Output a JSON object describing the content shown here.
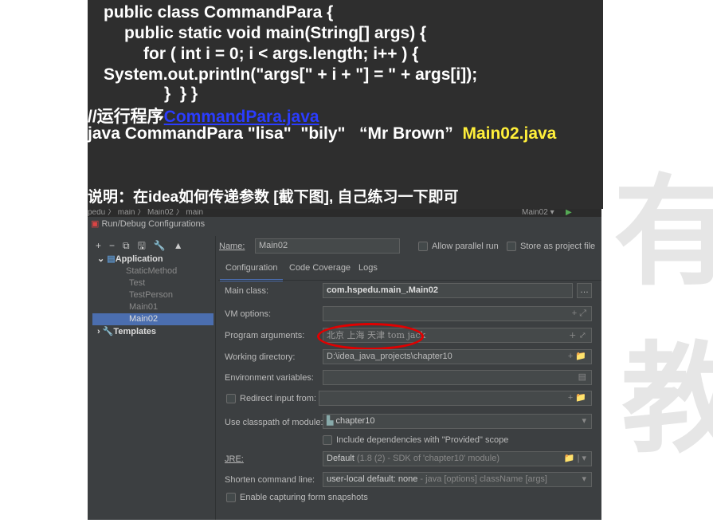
{
  "slide": {
    "code": [
      "public class CommandPara {",
      "public static void main(String[] args) {",
      "for ( int i = 0; i < args.length; i++ ) {",
      "System.out.println(\"args[\" + i + \"] = \" + args[i]);",
      "}  } }"
    ],
    "comment_prefix": "//运行程序",
    "comment_link": "CommandPara.java",
    "cmd": "java CommandPara \"lisa\"  \"bily\"   “Mr Brown”",
    "cmd_file": "Main02.java",
    "note": "说明：在idea如何传递参数 [截下图], 自己练习一下即可"
  },
  "ide": {
    "breadcrumb": "pedu 〉 main 〉 Main02 〉 main",
    "run_config": "Main02 ▾",
    "title": "Run/Debug Configurations",
    "toolbar": [
      "+",
      "−",
      "⧉",
      "🖫",
      "🔧",
      "▲"
    ],
    "tree": {
      "root": "Application",
      "items": [
        "StaticMethod",
        "Test",
        "TestPerson",
        "Main01",
        "Main02"
      ],
      "selected": "Main02",
      "templates": "Templates"
    },
    "name_label": "Name:",
    "name_value": "Main02",
    "allow_parallel": "Allow parallel run",
    "store_project": "Store as project file",
    "tabs": [
      "Configuration",
      "Code Coverage",
      "Logs"
    ],
    "main_class_label": "Main class:",
    "main_class": "com.hspedu.main_.Main02",
    "vm_label": "VM options:",
    "vm_value": "",
    "args_label": "Program arguments:",
    "args_value": "北京 上海 天津 tom jack",
    "wd_label": "Working directory:",
    "wd_value": "D:\\idea_java_projects\\chapter10",
    "env_label": "Environment variables:",
    "redirect_label": "Redirect input from:",
    "classpath_label": "Use classpath of module:",
    "classpath_value": "chapter10",
    "include_deps": "Include dependencies with \"Provided\" scope",
    "jre_label": "JRE:",
    "jre_value": "Default",
    "jre_hint": "(1.8 (2) - SDK of 'chapter10' module)",
    "shorten_label": "Shorten command line:",
    "shorten_value": "user-local default: none",
    "shorten_hint": "- java [options] className [args]",
    "snapshots": "Enable capturing form snapshots",
    "highlight_color": "#e00000",
    "accent": "#4b6eaf"
  }
}
